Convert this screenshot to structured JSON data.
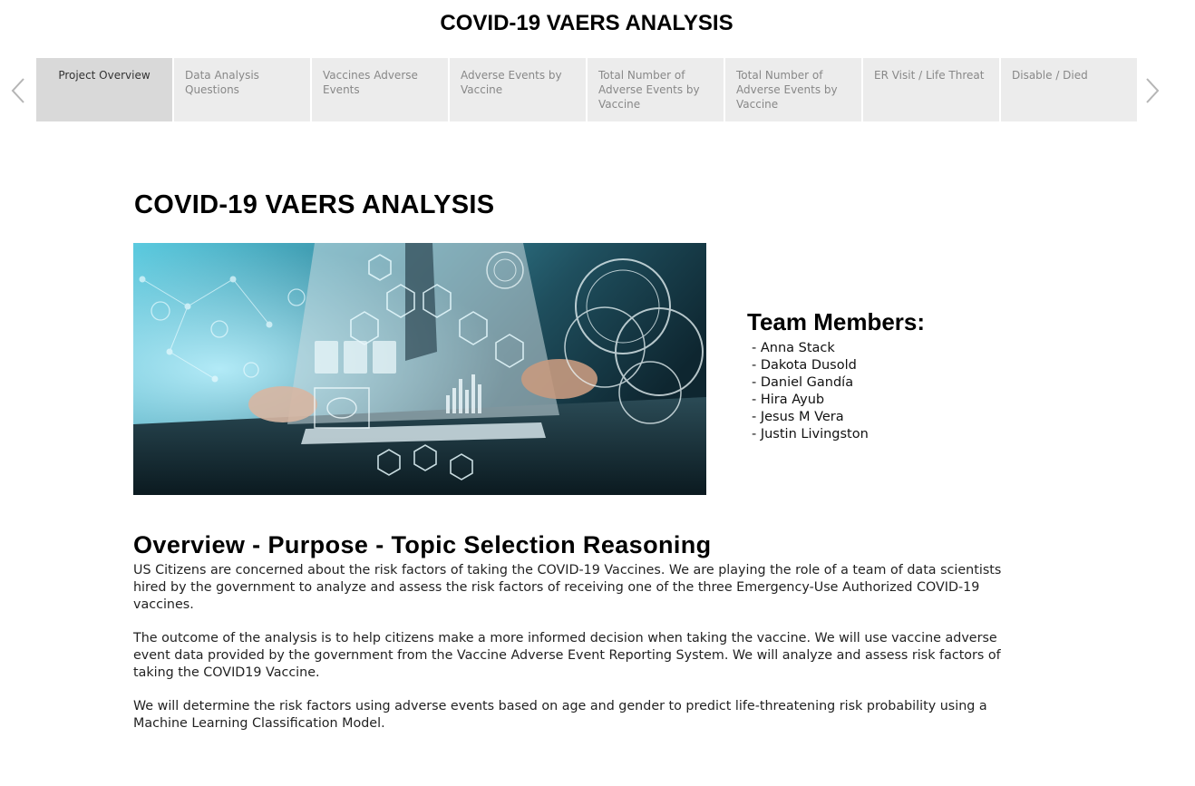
{
  "header": {
    "title": "COVID-19 VAERS ANALYSIS"
  },
  "nav": {
    "prev_icon": "chevron-left-icon",
    "next_icon": "chevron-right-icon",
    "tabs": [
      {
        "label": "Project Overview",
        "active": true
      },
      {
        "label": "Data Analysis Questions",
        "active": false
      },
      {
        "label": "Vaccines Adverse Events",
        "active": false
      },
      {
        "label": "Adverse Events by Vaccine",
        "active": false
      },
      {
        "label": "Total Number of Adverse Events by Vaccine",
        "active": false
      },
      {
        "label": "Total Number of Adverse Events by Vaccine",
        "active": false
      },
      {
        "label": "ER Visit / Life Threat",
        "active": false
      },
      {
        "label": "Disable / Died",
        "active": false
      }
    ]
  },
  "main": {
    "heading": "COVID-19 VAERS ANALYSIS",
    "team": {
      "title": "Team Members:",
      "members": [
        "- Anna Stack",
        "- Dakota Dusold",
        "- Daniel Gandía",
        "- Hira Ayub",
        "- Jesus M Vera",
        "- Justin Livingston"
      ]
    },
    "overview": {
      "heading": "Overview - Purpose - Topic Selection Reasoning",
      "paragraphs": [
        "US Citizens are concerned about the risk factors of taking the COVID-19 Vaccines. We are playing the role of a team of data scientists hired by the government to analyze and assess the risk factors of receiving one of the three Emergency-Use Authorized COVID-19 vaccines.",
        "The outcome of the analysis is to help citizens make a more informed decision when taking the vaccine. We will use vaccine adverse event data provided by the government from the Vaccine Adverse Event Reporting System. We will analyze and assess risk factors of taking the COVID19 Vaccine.",
        "We will determine the risk factors using adverse events based on age and gender to predict life-threatening risk probability using a Machine Learning Classification Model."
      ]
    }
  },
  "colors": {
    "tab_bg": "#ececec",
    "tab_active_bg": "#d9d9d9",
    "tab_text": "#888888",
    "image_teal": "#3fb6c9",
    "image_dark": "#12303a"
  }
}
